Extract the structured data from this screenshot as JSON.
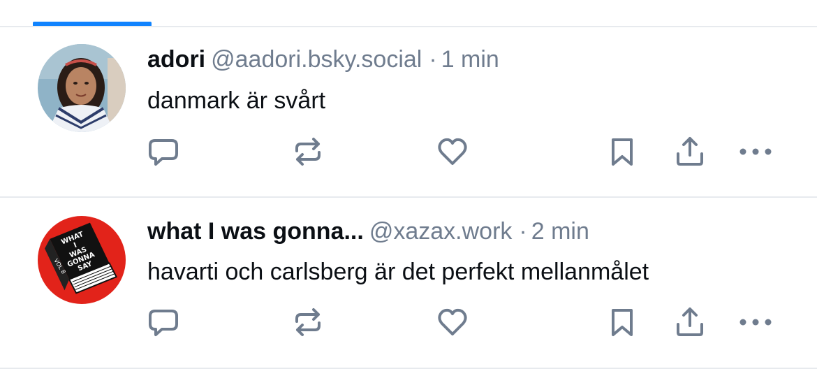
{
  "colors": {
    "accent": "#1083fe",
    "icon": "#6f7c8e",
    "divider": "#e7eaee"
  },
  "feed": {
    "posts": [
      {
        "display_name": "adori",
        "handle": "@aadori.bsky.social",
        "separator": "·",
        "time": "1 min",
        "text": "danmark är svårt",
        "avatar": "photo of a young girl"
      },
      {
        "display_name": "what I was gonna...",
        "handle": "@xazax.work",
        "separator": "·",
        "time": "2 min",
        "text": "havarti och carlsberg är det perfekt mellanmålet",
        "avatar": {
          "book_lines": [
            "WHAT",
            "I",
            "WAS",
            "GONNA",
            "SAY"
          ],
          "spine_text": "VOL 8",
          "background": "#e2231a"
        }
      }
    ]
  },
  "icons": {
    "reply": "speech-bubble-icon",
    "repost": "repost-arrows-icon",
    "like": "heart-icon",
    "bookmark": "bookmark-icon",
    "share": "share-upload-icon",
    "more": "ellipsis-icon"
  }
}
